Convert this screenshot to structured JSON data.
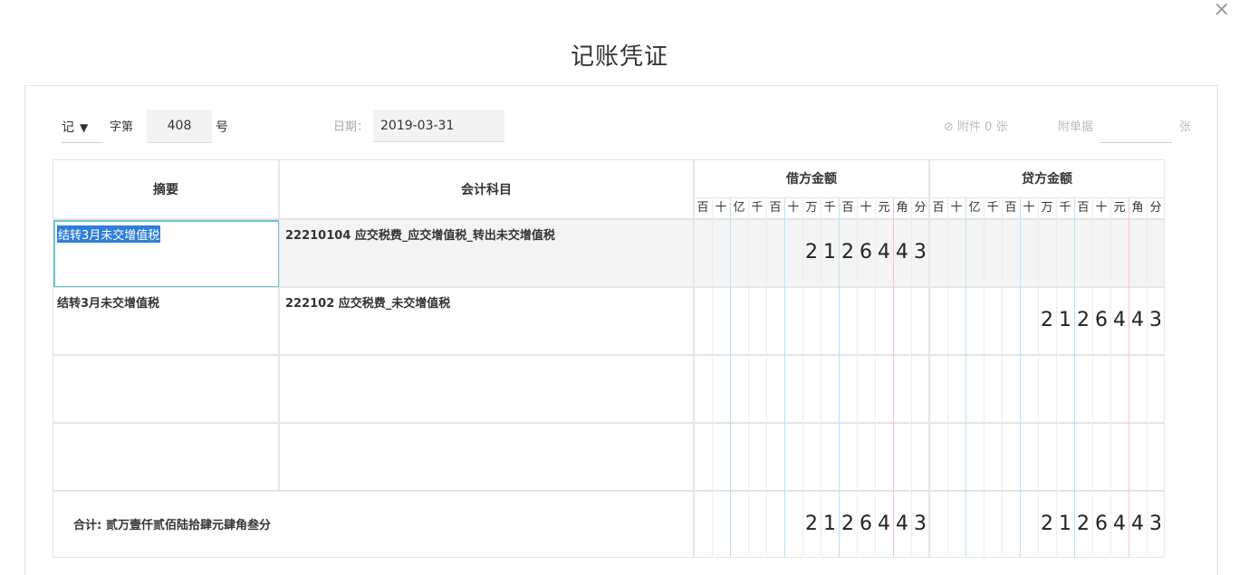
{
  "dialog": {
    "close_glyph": "×",
    "title": "记账凭证"
  },
  "header": {
    "word_value": "记",
    "caret_glyph": "▼",
    "zi_label": "字第",
    "voucher_number": "408",
    "hao_label": "号",
    "date_label": "日期：",
    "date_value": "2019-03-31",
    "attach_icon": "paperclip-icon",
    "attach_label": "附件 0 张",
    "attach_doc_label": "附单据",
    "zhang_label": "张"
  },
  "table": {
    "col_summary": "摘要",
    "col_account": "会计科目",
    "col_debit": "借方金额",
    "col_credit": "贷方金额",
    "units": [
      "百",
      "十",
      "亿",
      "千",
      "百",
      "十",
      "万",
      "千",
      "百",
      "十",
      "元",
      "角",
      "分"
    ],
    "rows": [
      {
        "summary": "结转3月未交增值税",
        "account": "22210104 应交税费_应交增值税_转出未交增值税",
        "debit": "2126443",
        "credit": ""
      },
      {
        "summary": "结转3月未交增值税",
        "account": "222102 应交税费_未交增值税",
        "debit": "",
        "credit": "2126443"
      },
      {
        "summary": "",
        "account": "",
        "debit": "",
        "credit": ""
      },
      {
        "summary": "",
        "account": "",
        "debit": "",
        "credit": ""
      }
    ],
    "total_label": "合计:",
    "total_words": "贰万壹仟贰佰陆拾肆元肆角叁分",
    "total_debit": "2126443",
    "total_credit": "2126443"
  },
  "colors": {
    "selection_border": "#6cc5cf",
    "selection_highlight": "#2f7ed8",
    "column_blue": "#bfe0f5",
    "column_red": "#f3c9c9"
  }
}
